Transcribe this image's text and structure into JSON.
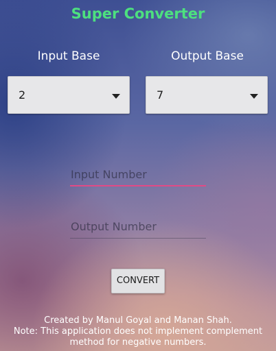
{
  "app": {
    "title": "Super Converter",
    "title_color": "#4de07f"
  },
  "input_base": {
    "label": "Input Base",
    "selected_value": "2"
  },
  "output_base": {
    "label": "Output Base",
    "selected_value": "7"
  },
  "input_number": {
    "placeholder": "Input Number",
    "value": "",
    "focused": true,
    "accent_color": "#e24a86"
  },
  "output_number": {
    "placeholder": "Output Number",
    "value": ""
  },
  "convert_button": {
    "label": "CONVERT"
  },
  "footer": {
    "credits": "Created by Manul Goyal and Manan Shah.",
    "note_line1": "Note: This application does not implement complement",
    "note_line2": "method for negative numbers."
  }
}
